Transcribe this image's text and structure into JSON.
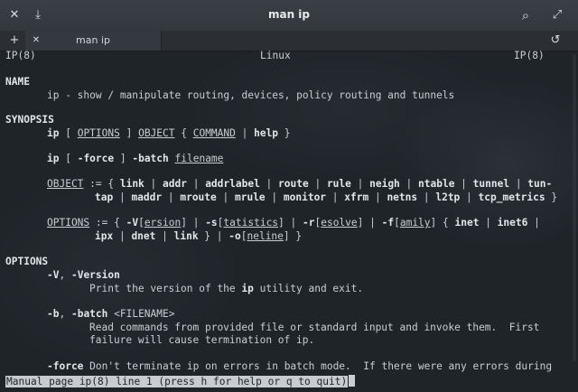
{
  "window": {
    "title": "man ip"
  },
  "tab": {
    "label": "man ip"
  },
  "terminal": {
    "header": {
      "left": "IP(8)",
      "center": "Linux",
      "right": "IP(8)"
    },
    "name_heading": "NAME",
    "name_desc": "ip - show / manipulate routing, devices, policy routing and tunnels",
    "synopsis_heading": "SYNOPSIS",
    "syn1": {
      "cmd": "ip",
      "p1": " [ ",
      "options": "OPTIONS",
      "p2": " ] ",
      "object": "OBJECT",
      "p3": " { ",
      "command": "COMMAND",
      "p4": " | ",
      "help": "help",
      "p5": " }"
    },
    "syn2": {
      "cmd": "ip",
      "p1": " [ ",
      "force": "-force",
      "p2": " ] ",
      "batch": "-batch",
      "p3": " ",
      "filename": "filename"
    },
    "obj1": {
      "object": "OBJECT",
      "p0": " := { ",
      "link": "link",
      "addr": "addr",
      "addrlabel": "addrlabel",
      "route": "route",
      "rule": "rule",
      "neigh": "neigh",
      "ntable": "ntable",
      "tunnel": "tunnel",
      "tun": "tun-"
    },
    "obj2": {
      "tap": "tap",
      "maddr": "maddr",
      "mroute": "mroute",
      "mrule": "mrule",
      "monitor": "monitor",
      "xfrm": "xfrm",
      "netns": "netns",
      "l2tp": "l2tp",
      "tcp_metrics": "tcp_metrics",
      "end": " }"
    },
    "opt1": {
      "options": "OPTIONS",
      "p0": " := { ",
      "V": "-V",
      "ersion": "ersion",
      "s": "-s",
      "tatistics": "tatistics",
      "r": "-r",
      "esolve": "esolve",
      "f": "-f",
      "amily": "amily",
      "p5": " { ",
      "inet": "inet",
      "inet6": "inet6",
      "p7": " |"
    },
    "opt2": {
      "ipx": "ipx",
      "dnet": "dnet",
      "link": "link",
      "p3": " } | ",
      "o": "-o",
      "neline": "neline",
      "end": " }"
    },
    "options_heading": "OPTIONS",
    "optV": {
      "V": "-V",
      "sep": ", ",
      "Version": "-Version"
    },
    "optV_desc": {
      "pre": "Print the version of the ",
      "ip": "ip",
      "post": " utility and exit."
    },
    "optb": {
      "b": "-b",
      "sep": ", ",
      "batch": "-batch",
      "arg": " <FILENAME>"
    },
    "optb_desc1": "Read commands from provided file or standard input and invoke them.  First",
    "optb_desc2": "failure will cause termination of ip.",
    "optforce": {
      "force": "-force",
      "desc": " Don't terminate ip on errors in batch mode.  If there were any errors during"
    },
    "status_line": "Manual page ip(8) line 1 (press h for help or q to quit)"
  }
}
